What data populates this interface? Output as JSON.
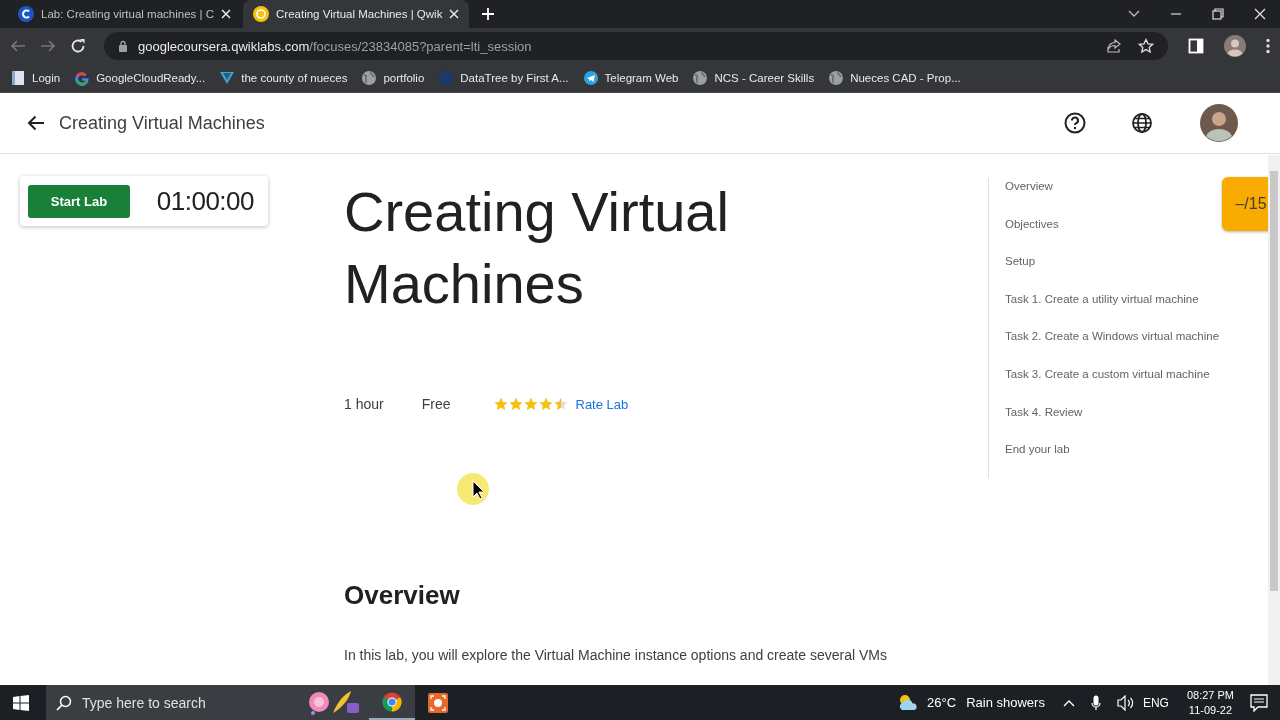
{
  "browser": {
    "tabs": [
      {
        "title": "Lab: Creating virtual machines | C",
        "kind": "coursera",
        "selected": false
      },
      {
        "title": "Creating Virtual Machines | Qwik",
        "kind": "qwiklabs",
        "selected": true
      }
    ],
    "url_host": "googlecoursera.qwiklabs.com",
    "url_path": "/focuses/23834085?parent=lti_session",
    "bookmarks": [
      {
        "label": "Login",
        "kind": "page"
      },
      {
        "label": "GoogleCloudReady...",
        "kind": "google"
      },
      {
        "label": "the county of nueces",
        "kind": "triangle"
      },
      {
        "label": "portfolio",
        "kind": "globe"
      },
      {
        "label": "DataTree by First A...",
        "kind": "datatree"
      },
      {
        "label": "Telegram Web",
        "kind": "telegram"
      },
      {
        "label": "NCS - Career Skills",
        "kind": "globe"
      },
      {
        "label": "Nueces CAD - Prop...",
        "kind": "globe"
      }
    ]
  },
  "page": {
    "header_title": "Creating Virtual Machines",
    "start_button": "Start Lab",
    "timer": "01:00:00",
    "title": "Creating Virtual Machines",
    "meta": [
      "1 hour",
      "Free"
    ],
    "rating": {
      "stars": 4.5,
      "link": "Rate Lab"
    },
    "section_heading": "Overview",
    "paragraph": "In this lab, you will explore the Virtual Machine instance options and create several VMs",
    "toc": [
      {
        "label": "Overview"
      },
      {
        "label": "Objectives"
      },
      {
        "label": "Setup"
      },
      {
        "label": "Task 1. Create a utility virtual machine"
      },
      {
        "label": "Task 2. Create a Windows virtual machine"
      },
      {
        "label": "Task 3. Create a custom virtual machine"
      },
      {
        "label": "Task 4. Review"
      },
      {
        "label": "End your lab"
      }
    ],
    "score": "–/15"
  },
  "taskbar": {
    "search_placeholder": "Type here to search",
    "temperature": "26°C",
    "weather": "Rain showers",
    "language": "ENG",
    "time": "08:27 PM",
    "date": "11-09-22"
  }
}
